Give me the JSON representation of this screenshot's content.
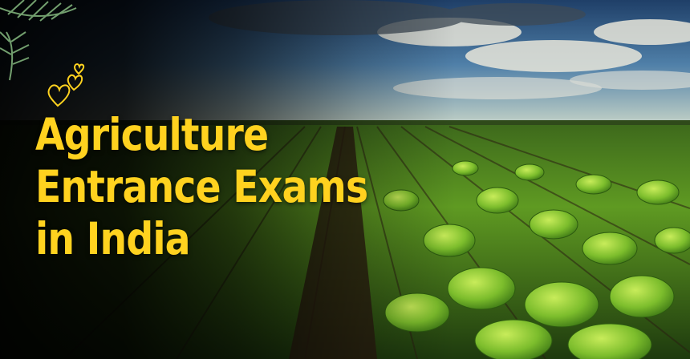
{
  "banner": {
    "headline_lines": [
      "Agriculture",
      "Entrance Exams",
      "in India"
    ]
  },
  "decorations": {
    "top_left": "palm-leaf-icon",
    "accent": "hearts-icon"
  },
  "colors": {
    "headline": "#ffd21f",
    "sky": "#2f5f8f",
    "crop": "#6aa526",
    "background": "#0b0c08"
  }
}
